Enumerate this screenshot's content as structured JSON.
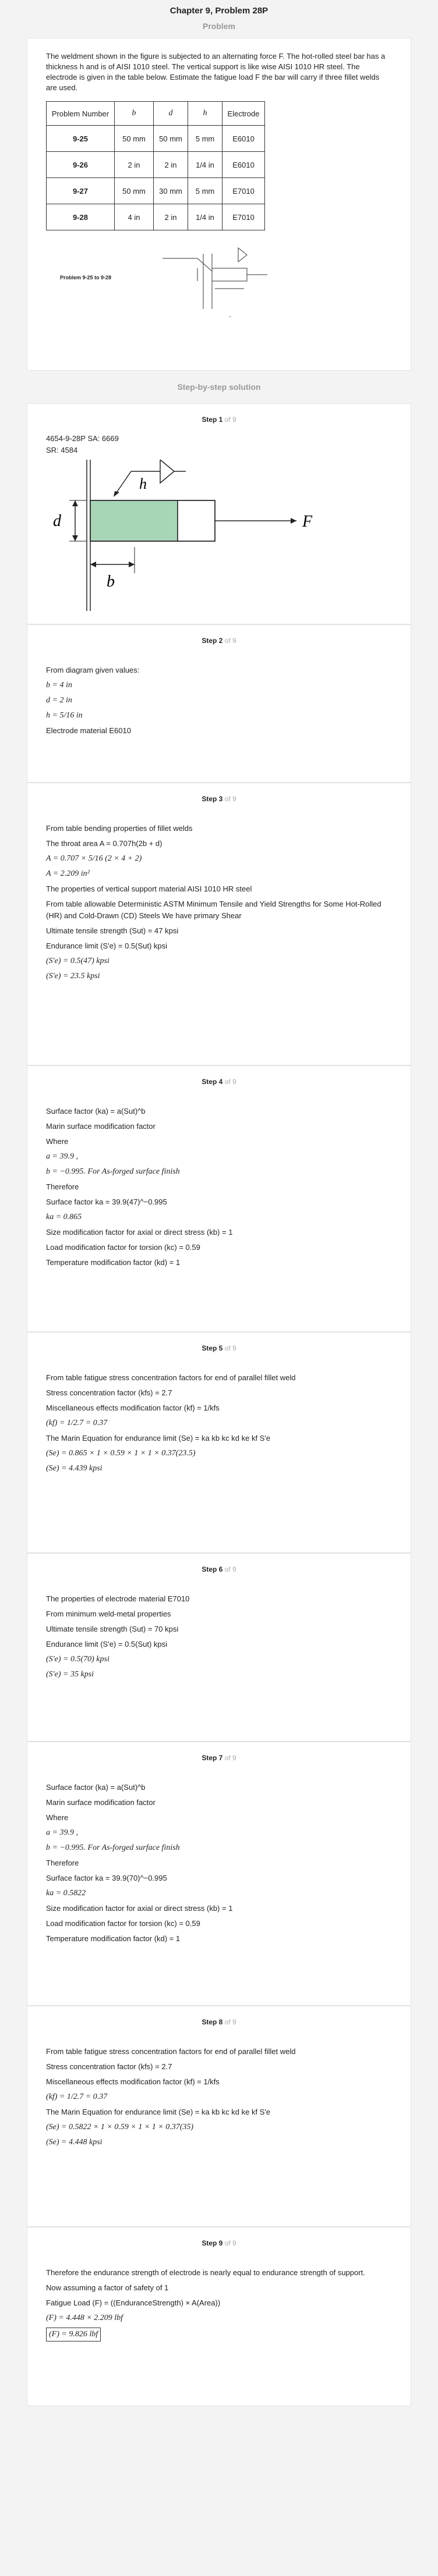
{
  "header": {
    "title": "Chapter 9, Problem 28P",
    "problem_label": "Problem",
    "solution_label": "Step-by-step solution"
  },
  "problem": {
    "text": "The weldment shown in the figure is subjected to an alternating force F. The hot-rolled steel bar has a thickness h and is of AISI 1010 steel. The vertical support is like wise AISI 1010 HR steel. The electrode is given in the table below. Estimate the fatigue load F the bar will carry if three fillet welds are used.",
    "table": {
      "headers": [
        "Problem Number",
        "b",
        "d",
        "h",
        "Electrode"
      ],
      "rows": [
        [
          "9-25",
          "50 mm",
          "50 mm",
          "5 mm",
          "E6010"
        ],
        [
          "9-26",
          "2 in",
          "2 in",
          "1/4 in",
          "E6010"
        ],
        [
          "9-27",
          "50 mm",
          "30 mm",
          "5 mm",
          "E7010"
        ],
        [
          "9-28",
          "4 in",
          "2 in",
          "1/4 in",
          "E7010"
        ]
      ]
    },
    "figure_caption": "Problem 9-25 to 9-28"
  },
  "step_of": "of 9",
  "steps": [
    {
      "n": "Step 1",
      "lines": [
        "4654-9-28P SA: 6669",
        "SR: 4584"
      ],
      "fig": {
        "h": "h",
        "d": "d",
        "b": "b",
        "F": "F"
      }
    },
    {
      "n": "Step 2",
      "lines": [
        "From diagram given values:",
        "b = 4 in",
        "d = 2 in",
        "h = 5/16 in",
        "Electrode material E6010"
      ]
    },
    {
      "n": "Step 3",
      "lines": [
        "From table bending properties of fillet welds",
        "The throat area  A = 0.707h(2b + d)",
        "A = 0.707 × 5/16 (2 × 4 + 2)",
        "A = 2.209  in²",
        "The properties of vertical support material AISI 1010 HR steel",
        "From table allowable Deterministic ASTM Minimum Tensile and Yield Strengths for Some Hot-Rolled (HR) and Cold-Drawn (CD) Steels We have primary Shear",
        "Ultimate tensile strength (Sut) = 47  kpsi",
        "Endurance limit (S'e) = 0.5(Sut)  kpsi",
        "(S'e) = 0.5(47) kpsi",
        "(S'e) = 23.5 kpsi"
      ]
    },
    {
      "n": "Step 4",
      "lines": [
        "Surface factor (ka) = a(Sut)^b",
        "Marin surface modification factor",
        "Where",
        "a = 39.9 ,",
        "b = −0.995. For As-forged surface finish",
        "Therefore",
        "Surface factor  ka = 39.9(47)^−0.995",
        "ka = 0.865",
        "Size modification factor for axial or direct stress (kb) = 1",
        "Load modification factor for torsion (kc) = 0.59",
        "Temperature modification factor (kd) = 1"
      ]
    },
    {
      "n": "Step 5",
      "lines": [
        "From table fatigue stress concentration factors for end of parallel fillet weld",
        "Stress concentration factor (kfs) = 2.7",
        "Miscellaneous effects modification factor (kf) = 1/kfs",
        "(kf) = 1/2.7 = 0.37",
        "The Marin Equation for endurance limit (Se) = ka kb kc kd ke kf S'e",
        "(Se) = 0.865 × 1 × 0.59 × 1 × 1 × 0.37(23.5)",
        "(Se) = 4.439 kpsi"
      ]
    },
    {
      "n": "Step 6",
      "lines": [
        "The properties of electrode material E7010",
        "From minimum weld-metal properties",
        "Ultimate tensile strength (Sut) = 70 kpsi",
        "Endurance limit (S'e) = 0.5(Sut)  kpsi",
        "(S'e) = 0.5(70)  kpsi",
        "(S'e) = 35  kpsi"
      ]
    },
    {
      "n": "Step 7",
      "lines": [
        "Surface factor (ka) = a(Sut)^b",
        "Marin surface modification factor",
        "Where",
        "a = 39.9 ,",
        "b = −0.995. For As-forged surface finish",
        "Therefore",
        "Surface factor  ka = 39.9(70)^−0.995",
        "ka = 0.5822",
        "Size modification factor for axial or direct stress (kb) = 1",
        "Load modification factor for torsion (kc) = 0.59",
        "Temperature modification factor (kd) = 1"
      ]
    },
    {
      "n": "Step 8",
      "lines": [
        "From table fatigue stress concentration factors for end of parallel fillet weld",
        "Stress concentration factor (kfs) = 2.7",
        "Miscellaneous effects modification factor (kf) = 1/kfs",
        "(kf) = 1/2.7 = 0.37",
        "The Marin Equation for endurance limit (Se) = ka kb kc kd ke kf S'e",
        "(Se) = 0.5822 × 1 × 0.59 × 1 × 1 × 0.37(35)",
        "(Se) = 4.448 kpsi"
      ]
    },
    {
      "n": "Step 9",
      "lines": [
        "Therefore the endurance strength of electrode is nearly equal to endurance strength of support.",
        "Now assuming a factor of safety of 1",
        "Fatigue Load (F) = ((EnduranceStrength) × A(Area))",
        "(F) = 4.448 × 2.209 lbf",
        "(F) = 9.826 lbf"
      ]
    }
  ]
}
